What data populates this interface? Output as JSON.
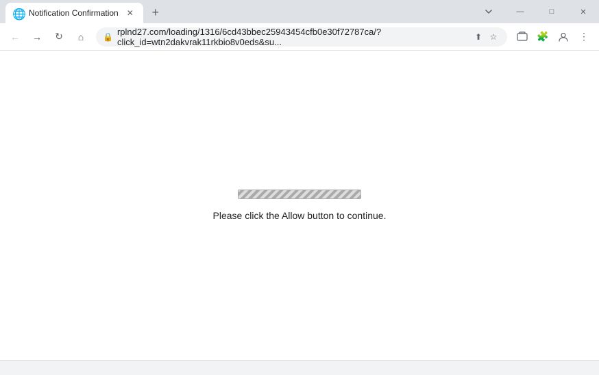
{
  "window": {
    "title": "Notification Confirmation",
    "favicon": "🌐"
  },
  "tabs": [
    {
      "label": "Notification Confirmation",
      "active": true
    }
  ],
  "controls": {
    "minimize": "—",
    "maximize": "□",
    "close": "✕"
  },
  "toolbar": {
    "back_label": "←",
    "forward_label": "→",
    "reload_label": "↻",
    "home_label": "⌂",
    "address": "rplnd27.com/loading/1316/6cd43bbec25943454cfb0e30f72787ca/?click_id=wtn2dakvrak11rkbio8v0eds&su...",
    "share_label": "⬆",
    "bookmark_label": "☆",
    "extensions_label": "🧩",
    "profile_label": "👤",
    "menu_label": "⋮",
    "new_tab_label": "+"
  },
  "page": {
    "loading_text": "Please click the Allow button to continue."
  }
}
